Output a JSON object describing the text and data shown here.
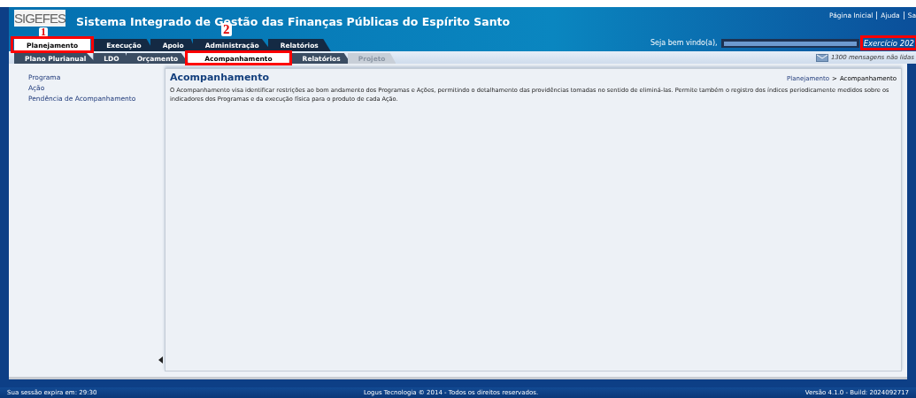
{
  "header": {
    "logo": "SIGEFES",
    "title": "Sistema Integrado de Gestão das Finanças Públicas do Espírito Santo",
    "links": [
      "Página Inicial",
      "Ajuda",
      "Sa"
    ],
    "welcome": "Seja bem vindo(a),",
    "exercise": "Exercício 202"
  },
  "tabs": [
    {
      "label": "Planejamento",
      "selected": true
    },
    {
      "label": "Execução",
      "selected": false
    },
    {
      "label": "Apoio",
      "selected": false
    },
    {
      "label": "Administração",
      "selected": false
    },
    {
      "label": "Relatórios",
      "selected": false
    }
  ],
  "subtabs": [
    {
      "label": "Plano Plurianual",
      "selected": false,
      "disabled": false
    },
    {
      "label": "LDO",
      "selected": false,
      "disabled": false
    },
    {
      "label": "Orçamento",
      "selected": false,
      "disabled": false
    },
    {
      "label": "Acompanhamento",
      "selected": true,
      "disabled": false
    },
    {
      "label": "Relatórios",
      "selected": false,
      "disabled": false
    },
    {
      "label": "Projeto",
      "selected": false,
      "disabled": true
    }
  ],
  "messages": "1300 mensagens não lidas",
  "sidebar": {
    "items": [
      "Programa",
      "Ação",
      "Pendência de Acompanhamento"
    ]
  },
  "content": {
    "title": "Acompanhamento",
    "breadcrumb": [
      "Planejamento",
      ">",
      "Acompanhamento"
    ],
    "description": "O Acompanhamento visa identificar restrições ao bom andamento dos Programas e Ações, permitindo o detalhamento das providências tomadas no sentido de eliminá-las. Permite também o registro dos índices periodicamente medidos sobre os indicadores dos Programas e da execução física para o produto de cada Ação."
  },
  "annotations": [
    "1",
    "2"
  ],
  "status_bar": {
    "session": "Sua sessão expira em: 29:30",
    "copyright": "Logus Tecnologia © 2014 - Todos os direitos reservados.",
    "version": "Versão 4.1.0 - Build: 2024092717"
  }
}
